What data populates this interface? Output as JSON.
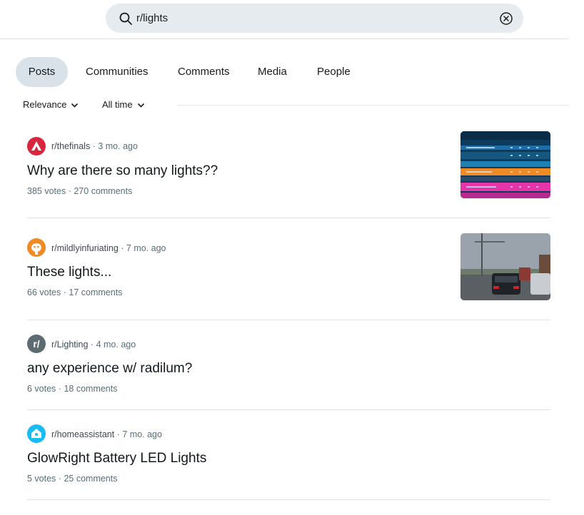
{
  "search": {
    "query": "r/lights"
  },
  "tabs": [
    {
      "label": "Posts",
      "active": true
    },
    {
      "label": "Communities"
    },
    {
      "label": "Comments"
    },
    {
      "label": "Media"
    },
    {
      "label": "People"
    }
  ],
  "filters": {
    "sort": "Relevance",
    "time": "All time"
  },
  "posts": [
    {
      "subreddit": "r/thefinals",
      "age": "3 mo. ago",
      "title": "Why are there so many lights??",
      "votes": "385 votes",
      "comments": "270 comments",
      "has_thumbnail": true,
      "icon": "thefinals-icon"
    },
    {
      "subreddit": "r/mildlyinfuriating",
      "age": "7 mo. ago",
      "title": "These lights...",
      "votes": "66 votes",
      "comments": "17 comments",
      "has_thumbnail": true,
      "icon": "mildlyinfuriating-icon"
    },
    {
      "subreddit": "r/Lighting",
      "age": "4 mo. ago",
      "title": "any experience w/ radilum?",
      "votes": "6 votes",
      "comments": "18 comments",
      "has_thumbnail": false,
      "icon": "r-slash-icon"
    },
    {
      "subreddit": "r/homeassistant",
      "age": "7 mo. ago",
      "title": "GlowRight Battery LED Lights",
      "votes": "5 votes",
      "comments": "25 comments",
      "has_thumbnail": false,
      "icon": "homeassistant-icon"
    }
  ],
  "separator": "·",
  "colors": {
    "search_bg": "#e5ebee",
    "active_tab_bg": "#d9e2e8",
    "meta_text": "#576f76",
    "thefinals_red": "#d7263d",
    "mildly_orange": "#f08a24",
    "lighting_gray": "#5f6b73",
    "homeassistant_blue": "#18bcf2"
  }
}
